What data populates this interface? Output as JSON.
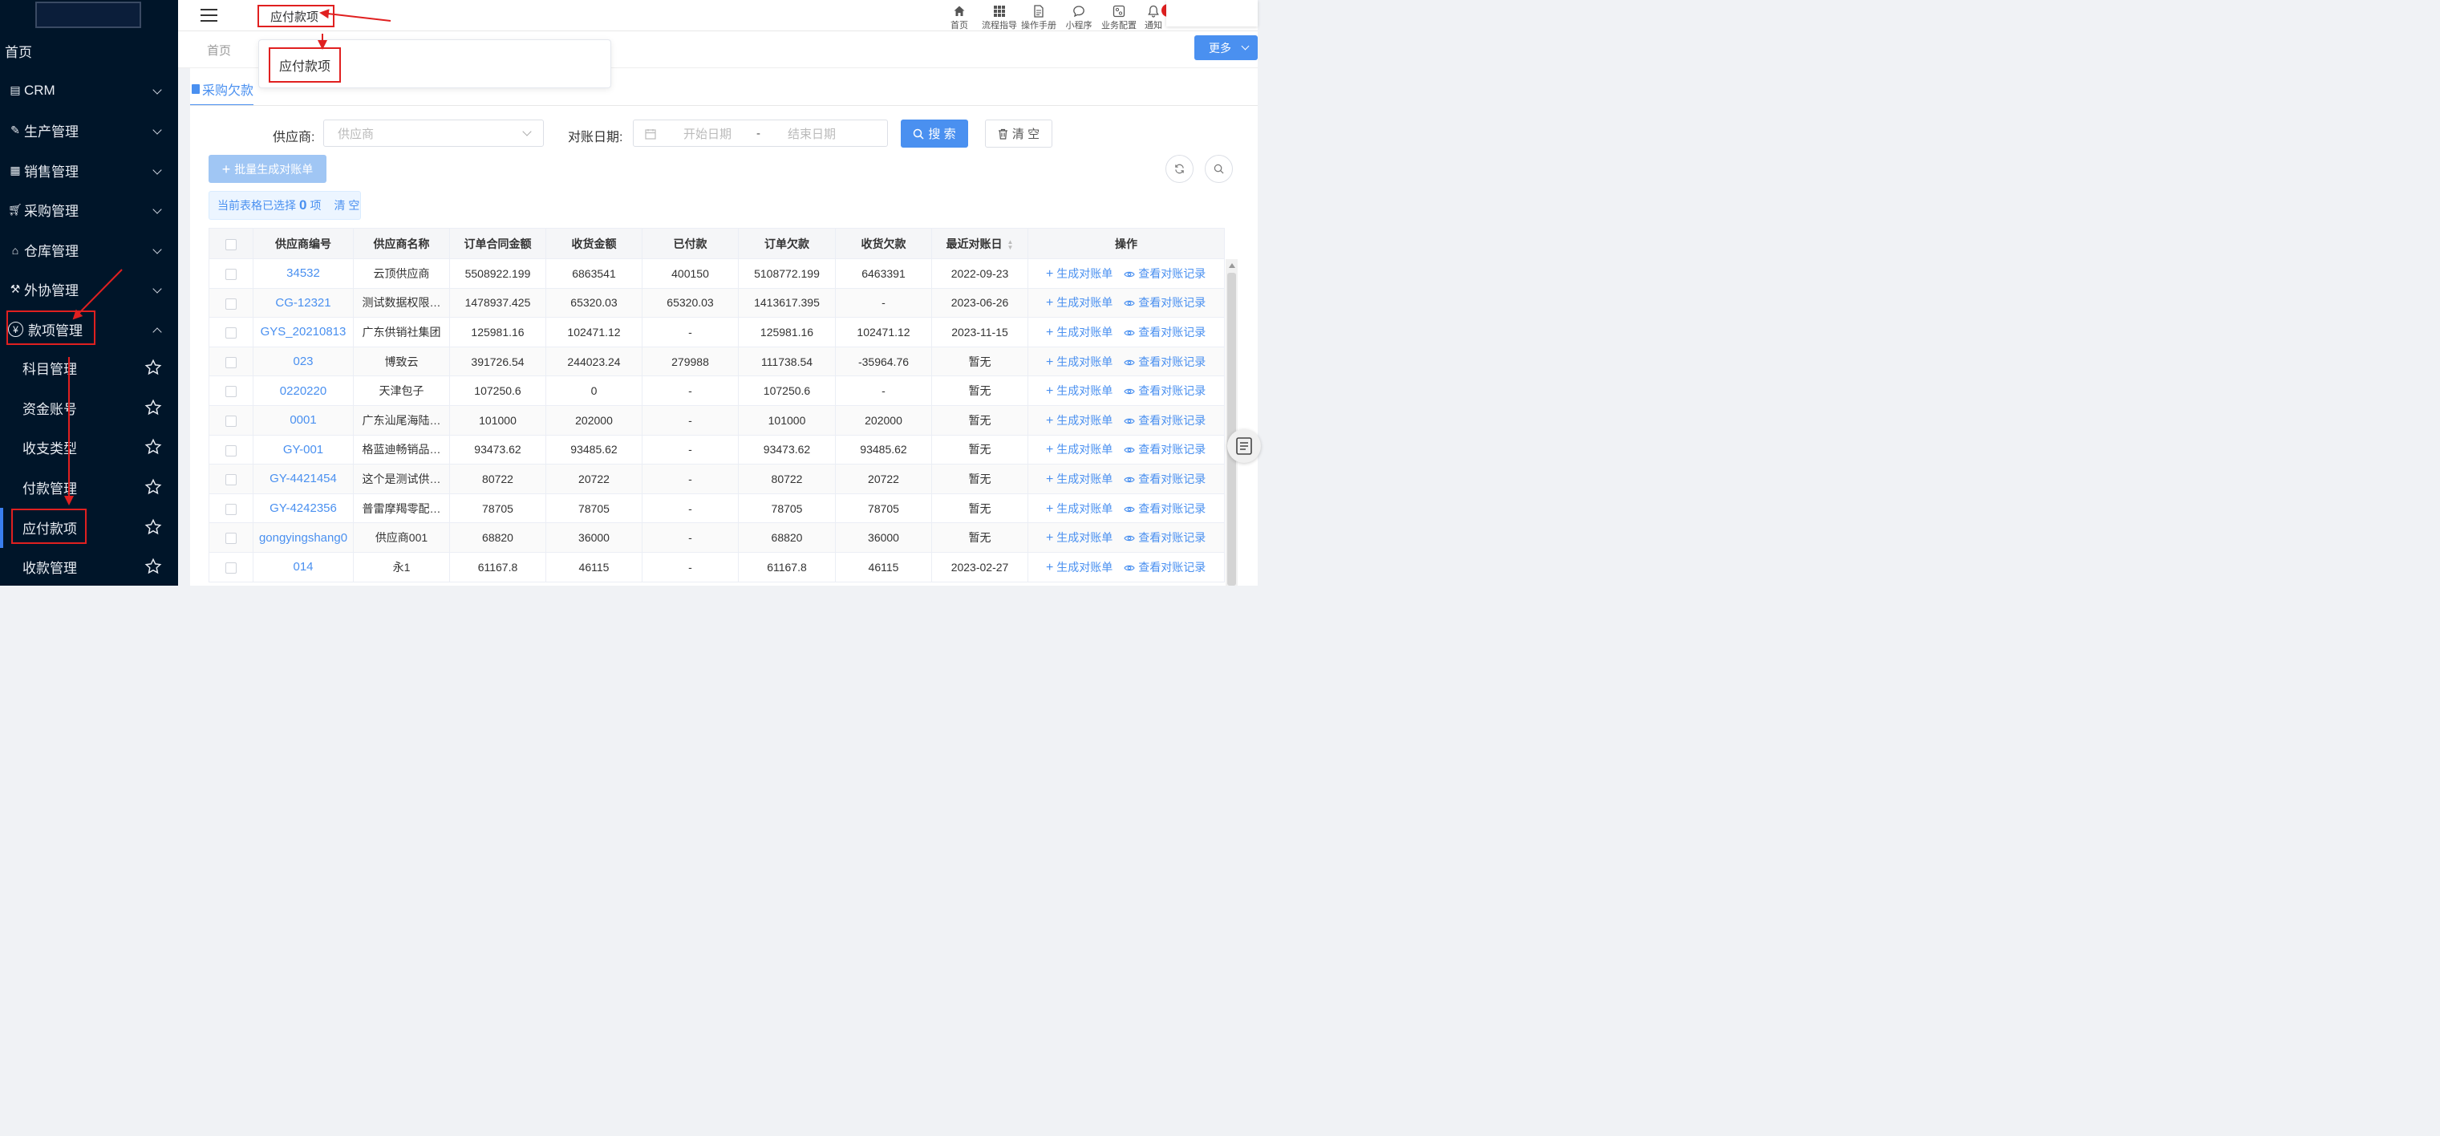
{
  "sidebar": {
    "home": "首页",
    "crm": "CRM",
    "production": "生产管理",
    "sales": "销售管理",
    "purchase": "采购管理",
    "warehouse": "仓库管理",
    "outsource": "外协管理",
    "payment_mgmt": "款项管理",
    "subitems": [
      "科目管理",
      "资金账号",
      "收支类型",
      "付款管理",
      "应付款项",
      "收款管理"
    ]
  },
  "topbar": {
    "breadcrumb": "应付款项",
    "tools": [
      "首页",
      "流程指导",
      "操作手册",
      "小程序",
      "业务配置",
      "通知"
    ]
  },
  "tabs": {
    "home": "首页",
    "more": "更多"
  },
  "dropdown": {
    "item": "应付款项"
  },
  "section": {
    "tab": "采购欠款"
  },
  "filters": {
    "supplier_label": "供应商:",
    "supplier_placeholder": "供应商",
    "date_label": "对账日期:",
    "start_placeholder": "开始日期",
    "end_placeholder": "结束日期",
    "sep": "-",
    "search": "搜 索",
    "clear": "清 空"
  },
  "toolbar": {
    "batch": "批量生成对账单"
  },
  "selection": {
    "prefix": "当前表格已选择",
    "count": "0",
    "suffix": "项",
    "clear": "清 空"
  },
  "table": {
    "headers": [
      "供应商编号",
      "供应商名称",
      "订单合同金额",
      "收货金额",
      "已付款",
      "订单欠款",
      "收货欠款",
      "最近对账日",
      "操作"
    ],
    "rows": [
      [
        "34532",
        "云顶供应商",
        "5508922.199",
        "6863541",
        "400150",
        "5108772.199",
        "6463391",
        "2022-09-23"
      ],
      [
        "CG-12321",
        "测试数据权限…",
        "1478937.425",
        "65320.03",
        "65320.03",
        "1413617.395",
        "-",
        "2023-06-26"
      ],
      [
        "GYS_20210813",
        "广东供销社集团",
        "125981.16",
        "102471.12",
        "-",
        "125981.16",
        "102471.12",
        "2023-11-15"
      ],
      [
        "023",
        "博致云",
        "391726.54",
        "244023.24",
        "279988",
        "111738.54",
        "-35964.76",
        "暂无"
      ],
      [
        "0220220",
        "天津包子",
        "107250.6",
        "0",
        "-",
        "107250.6",
        "-",
        "暂无"
      ],
      [
        "0001",
        "广东汕尾海陆…",
        "101000",
        "202000",
        "-",
        "101000",
        "202000",
        "暂无"
      ],
      [
        "GY-001",
        "格蓝迪畅销品…",
        "93473.62",
        "93485.62",
        "-",
        "93473.62",
        "93485.62",
        "暂无"
      ],
      [
        "GY-4421454",
        "这个是测试供…",
        "80722",
        "20722",
        "-",
        "80722",
        "20722",
        "暂无"
      ],
      [
        "GY-4242356",
        "普雷摩羯零配…",
        "78705",
        "78705",
        "-",
        "78705",
        "78705",
        "暂无"
      ],
      [
        "gongyingshang0",
        "供应商001",
        "68820",
        "36000",
        "-",
        "68820",
        "36000",
        "暂无"
      ],
      [
        "014",
        "永1",
        "61167.8",
        "46115",
        "-",
        "61167.8",
        "46115",
        "2023-02-27"
      ]
    ],
    "op_gen": "生成对账单",
    "op_view": "查看对账记录"
  }
}
